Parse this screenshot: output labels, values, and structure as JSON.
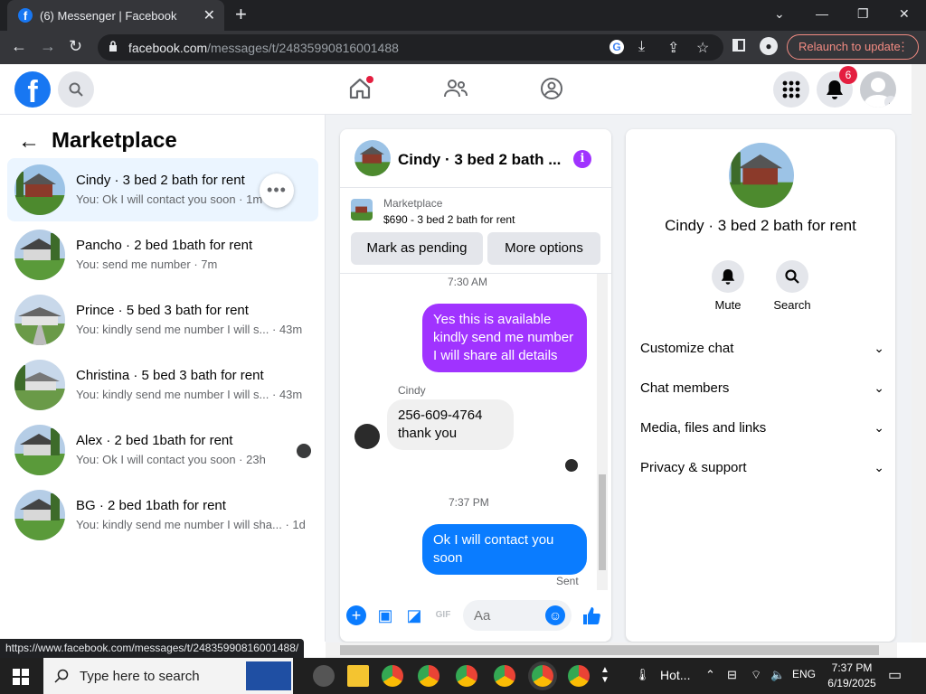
{
  "browser": {
    "tab_title": "(6) Messenger | Facebook",
    "url_host": "facebook.com",
    "url_path": "/messages/t/24835990816001488",
    "relaunch_label": "Relaunch to update",
    "status_url": "https://www.facebook.com/messages/t/24835990816001488/"
  },
  "header": {
    "notification_count": "6"
  },
  "sidebar": {
    "title": "Marketplace",
    "conversations": [
      {
        "name": "Cindy · 3 bed 2 bath for rent",
        "preview": "You: Ok I will contact you soon · 1m"
      },
      {
        "name": "Pancho · 2 bed 1bath for rent",
        "preview": "You: send me number · 7m"
      },
      {
        "name": "Prince · 5 bed 3 bath for rent",
        "preview": "You: kindly send me number I will s... · 43m"
      },
      {
        "name": "Christina · 5 bed 3 bath for rent",
        "preview": "You: kindly send me number I will s... · 43m"
      },
      {
        "name": "Alex · 2 bed 1bath for rent",
        "preview": "You: Ok I will contact you soon · 23h"
      },
      {
        "name": "BG · 2 bed 1bath for rent",
        "preview": "You: kindly send me number I will sha... · 1d"
      }
    ]
  },
  "chat": {
    "title": "Cindy · 3 bed 2 bath ...",
    "listing_source": "Marketplace",
    "listing_title": "$690 - 3 bed 2 bath for rent",
    "mark_pending_label": "Mark as pending",
    "more_options_label": "More options",
    "messages": [
      {
        "ts": "7:30 AM"
      },
      {
        "text": "Yes this is available kindly send me number I will share all details"
      },
      {
        "sender": "Cindy",
        "text": "256-609-4764 thank you"
      },
      {
        "ts": "7:37 PM"
      },
      {
        "text": "Ok I will contact you soon",
        "status": "Sent"
      }
    ],
    "input_placeholder": "Aa"
  },
  "details": {
    "name": "Cindy · 3 bed 2 bath for rent",
    "actions": [
      {
        "label": "Mute",
        "icon": "bell-icon"
      },
      {
        "label": "Search",
        "icon": "search-icon"
      }
    ],
    "sections": [
      "Customize chat",
      "Chat members",
      "Media, files and links",
      "Privacy & support"
    ]
  },
  "taskbar": {
    "search_placeholder": "Type here to search",
    "weather_text": "Hot...",
    "language": "ENG",
    "time": "7:37 PM",
    "date": "6/19/2025"
  },
  "colors": {
    "brand": "#1877f2",
    "accent": "#a033ff",
    "blue_bubble": "#0a7cff"
  }
}
